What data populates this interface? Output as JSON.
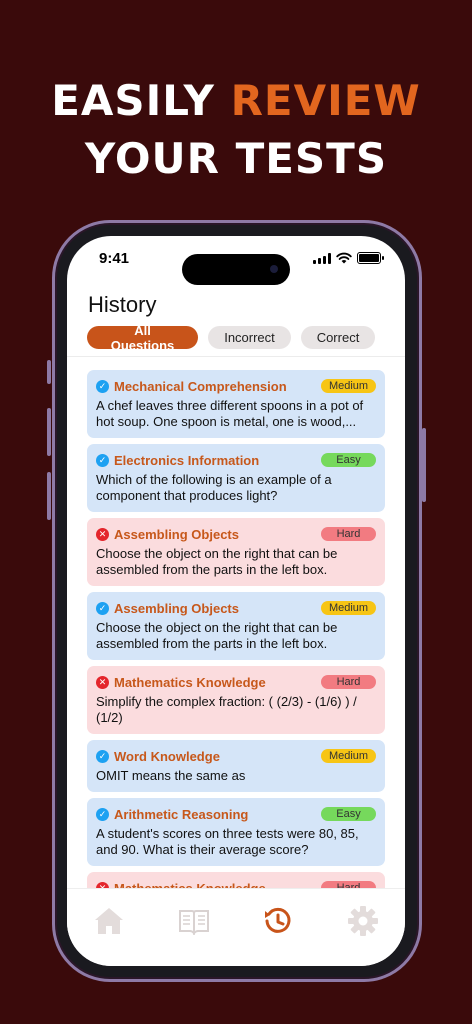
{
  "headline": {
    "line1_prefix": "Easily ",
    "line1_accent": "review",
    "line2": "your tests"
  },
  "colors": {
    "background": "#3a0a0b",
    "accent": "#e2661f",
    "chip_active": "#c8541a",
    "card_correct": "#d5e5f8",
    "card_wrong": "#fbdcde"
  },
  "status_bar": {
    "time": "9:41"
  },
  "page": {
    "title": "History"
  },
  "filters": [
    {
      "label": "All Questions",
      "active": true
    },
    {
      "label": "Incorrect",
      "active": false
    },
    {
      "label": "Correct",
      "active": false
    }
  ],
  "history": [
    {
      "subject": "Mechanical Comprehension",
      "difficulty": "Medium",
      "result": "correct",
      "question": "A chef leaves three different spoons in a pot of hot soup. One spoon is metal, one is wood,..."
    },
    {
      "subject": "Electronics Information",
      "difficulty": "Easy",
      "result": "correct",
      "question": "Which of the following is an example of a component that produces light?"
    },
    {
      "subject": "Assembling Objects",
      "difficulty": "Hard",
      "result": "incorrect",
      "question": "Choose the object on the right that can be assembled from the parts in the left box."
    },
    {
      "subject": "Assembling Objects",
      "difficulty": "Medium",
      "result": "correct",
      "question": "Choose the object on the right that can be assembled from the parts in the left box."
    },
    {
      "subject": "Mathematics Knowledge",
      "difficulty": "Hard",
      "result": "incorrect",
      "question": "Simplify the complex fraction: ( (2/3) - (1/6) ) / (1/2)"
    },
    {
      "subject": "Word Knowledge",
      "difficulty": "Medium",
      "result": "correct",
      "question": "OMIT means the same as"
    },
    {
      "subject": "Arithmetic Reasoning",
      "difficulty": "Easy",
      "result": "correct",
      "question": "A student's scores on three tests were 80, 85, and 90. What is their average score?"
    },
    {
      "subject": "Mathematics Knowledge",
      "difficulty": "Hard",
      "result": "incorrect",
      "question": ""
    }
  ],
  "tabbar": [
    {
      "icon": "home-icon",
      "active": false
    },
    {
      "icon": "book-icon",
      "active": false
    },
    {
      "icon": "history-icon",
      "active": true
    },
    {
      "icon": "gear-icon",
      "active": false
    }
  ]
}
